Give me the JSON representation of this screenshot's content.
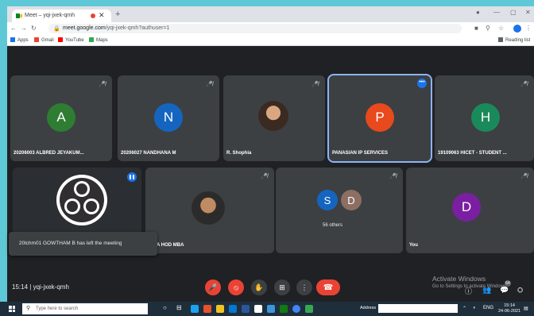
{
  "browser": {
    "tab_title": "Meet – yqi-jxek-qmh",
    "url_host": "meet.google.com",
    "url_path": "/yqi-jxek-qmh?authuser=1",
    "bookmarks": [
      "Apps",
      "Gmail",
      "YouTube",
      "Maps"
    ],
    "reading_list": "Reading list"
  },
  "tiles_row1": [
    {
      "name": "20206003 ALBRED JEYAKUM...",
      "initial": "A",
      "color": "#2e7d32"
    },
    {
      "name": "20206027 NANDHANA M",
      "initial": "N",
      "color": "#1565c0"
    },
    {
      "name": "R. Shophia",
      "initial": "",
      "color": "#5d4037"
    },
    {
      "name": "PANASIAN IP SERVICES",
      "initial": "P",
      "color": "#e8491d"
    },
    {
      "name": "19109063 HICET - STUDENT ...",
      "initial": "H",
      "color": "#1b8a5a"
    }
  ],
  "tiles_row2": [
    {
      "name": "",
      "initial": ""
    },
    {
      "name": "A HOD MBA",
      "initial": ""
    },
    {
      "name": "",
      "initial": ""
    },
    {
      "name": "You",
      "initial": "D",
      "color": "#7b1fa2"
    }
  ],
  "others": {
    "a": "S",
    "b": "D",
    "label": "56 others",
    "color_a": "#1565c0",
    "color_b": "#8d6e63"
  },
  "toast": "20lchm01 GOWTHAM B has left the meeting",
  "meeting": {
    "time": "15:14",
    "code": "yqi-jxek-qmh"
  },
  "watermark": {
    "line1": "Activate Windows",
    "line2": "Go to Settings to activate Windows."
  },
  "participant_count": "64",
  "taskbar": {
    "search_placeholder": "Type here to search",
    "address_label": "Address",
    "lang": "ENG",
    "time": "15:14",
    "date": "24-06-2021"
  }
}
